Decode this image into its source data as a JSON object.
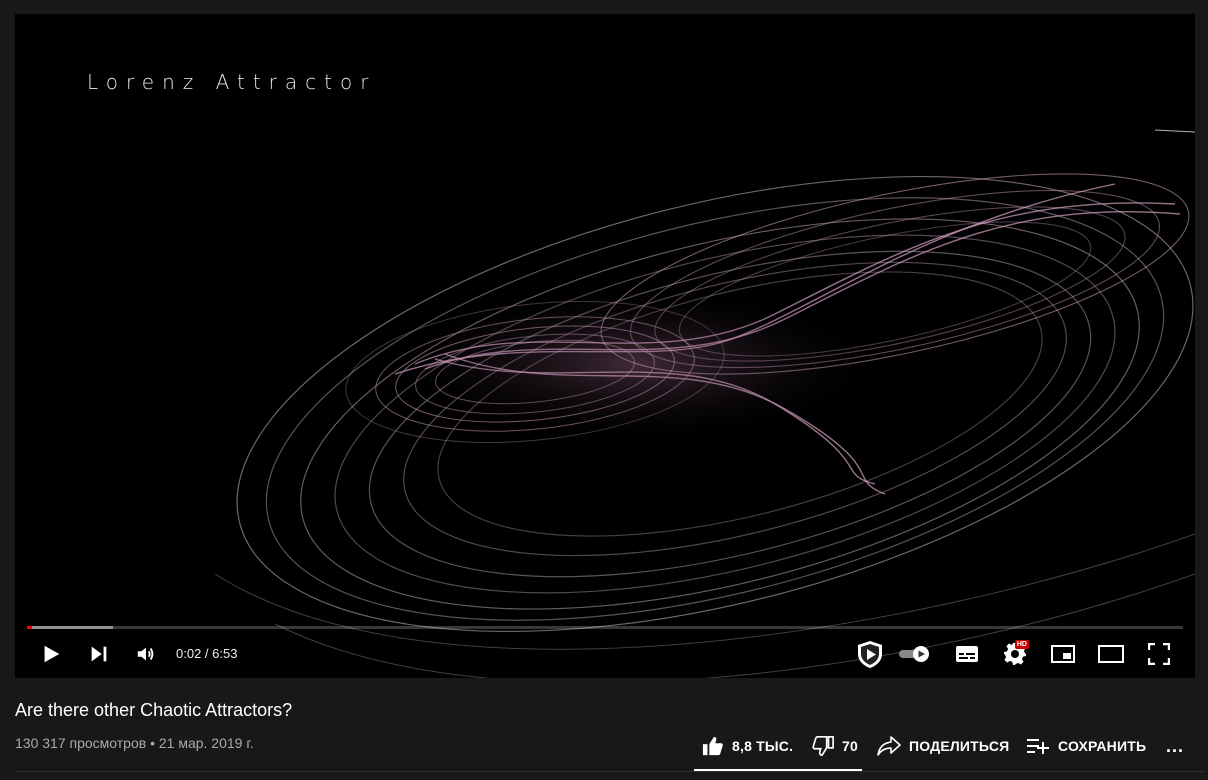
{
  "player": {
    "overlay_title": "Lorenz Attractor",
    "time": "0:02 / 6:53",
    "progress": {
      "played_fraction": 0.003,
      "loaded_fraction": 0.074
    },
    "controls": {
      "play_icon": "play-icon",
      "next_icon": "skip-next-icon",
      "volume_icon": "volume-icon",
      "ad_shield_icon": "shield-play-icon",
      "autoplay_icon": "autoplay-toggle-icon",
      "subtitles_icon": "subtitles-icon",
      "settings_icon": "gear-icon",
      "settings_badge": "HD",
      "miniplayer_icon": "miniplayer-icon",
      "theater_icon": "theater-mode-icon",
      "fullscreen_icon": "fullscreen-icon"
    }
  },
  "video": {
    "title": "Are there other Chaotic Attractors?",
    "meta": "130 317 просмотров • 21 мар. 2019 г."
  },
  "actions": {
    "like_count": "8,8 ТЫС.",
    "dislike_count": "70",
    "share_label": "ПОДЕЛИТЬСЯ",
    "save_label": "СОХРАНИТЬ",
    "more_label": "..."
  },
  "colors": {
    "accent": "#ff0000",
    "background": "#181818",
    "trail": "#c98fb4"
  }
}
